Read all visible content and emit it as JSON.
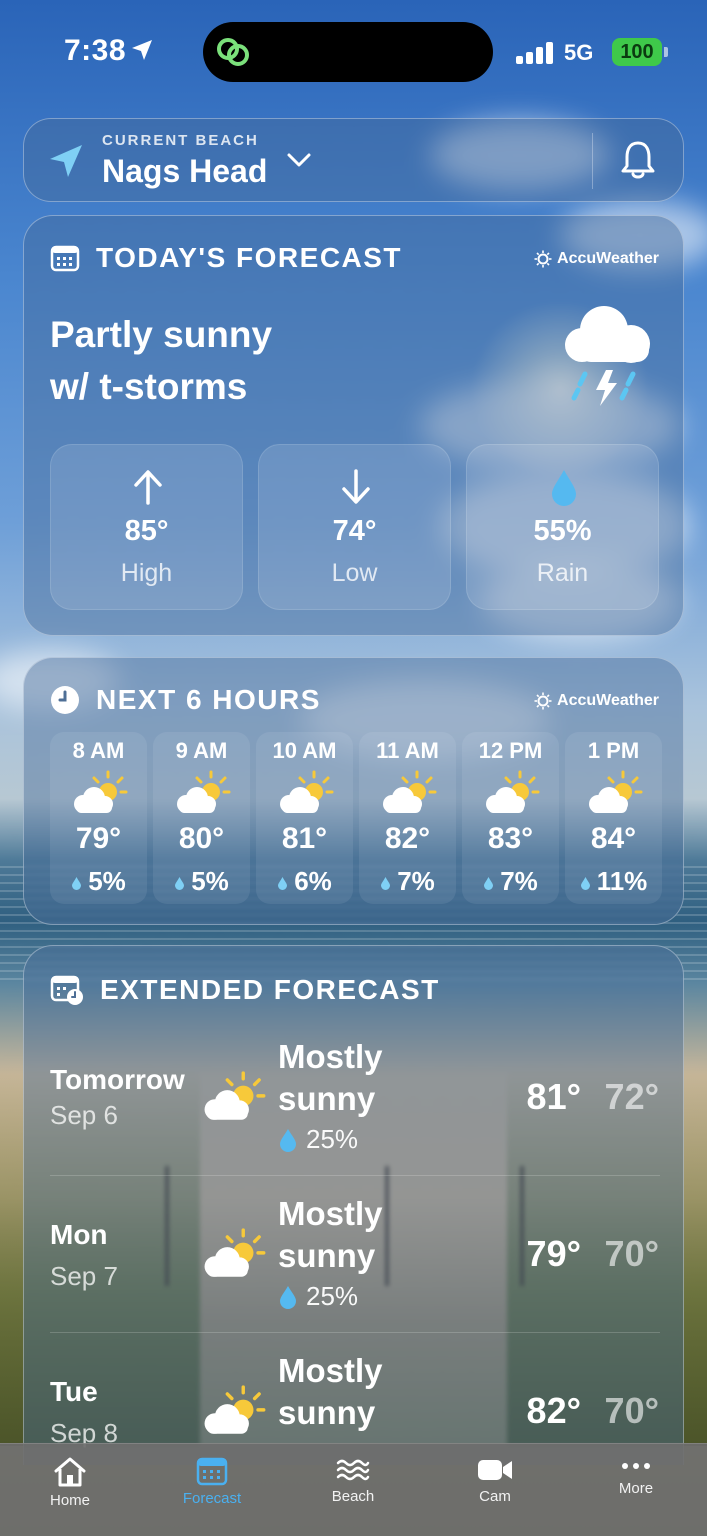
{
  "status_bar": {
    "time": "7:38",
    "network": "5G",
    "battery": "100"
  },
  "location": {
    "kicker": "CURRENT BEACH",
    "name": "Nags Head"
  },
  "today": {
    "title": "TODAY'S FORECAST",
    "provider": "AccuWeather",
    "condition_line1": "Partly sunny",
    "condition_line2": "w/ t-storms",
    "icon": "thunderstorm-icon",
    "stats": [
      {
        "value": "85°",
        "label": "High",
        "icon": "arrow-up-icon"
      },
      {
        "value": "74°",
        "label": "Low",
        "icon": "arrow-down-icon"
      },
      {
        "value": "55%",
        "label": "Rain",
        "icon": "raindrop-icon"
      }
    ]
  },
  "hourly": {
    "title": "NEXT 6 HOURS",
    "provider": "AccuWeather",
    "hours": [
      {
        "time": "8 AM",
        "temp": "79°",
        "precip": "5%"
      },
      {
        "time": "9 AM",
        "temp": "80°",
        "precip": "5%"
      },
      {
        "time": "10 AM",
        "temp": "81°",
        "precip": "6%"
      },
      {
        "time": "11 AM",
        "temp": "82°",
        "precip": "7%"
      },
      {
        "time": "12 PM",
        "temp": "83°",
        "precip": "7%"
      },
      {
        "time": "1 PM",
        "temp": "84°",
        "precip": "11%"
      }
    ]
  },
  "extended": {
    "title": "EXTENDED FORECAST",
    "days": [
      {
        "day": "Tomorrow",
        "date": "Sep 6",
        "cond1": "Mostly",
        "cond2": "sunny",
        "rain": "25%",
        "high": "81°",
        "low": "72°"
      },
      {
        "day": "Mon",
        "date": "Sep 7",
        "cond1": "Mostly",
        "cond2": "sunny",
        "rain": "25%",
        "high": "79°",
        "low": "70°"
      },
      {
        "day": "Tue",
        "date": "Sep 8",
        "cond1": "Mostly",
        "cond2": "sunny",
        "rain": "",
        "high": "82°",
        "low": "70°"
      }
    ]
  },
  "tabs": [
    {
      "label": "Home",
      "icon": "home-icon"
    },
    {
      "label": "Forecast",
      "icon": "calendar-icon",
      "active": true
    },
    {
      "label": "Beach",
      "icon": "waves-icon"
    },
    {
      "label": "Cam",
      "icon": "video-camera-icon"
    },
    {
      "label": "More",
      "icon": "more-dots-icon"
    }
  ],
  "colors": {
    "accent": "#4ab0f0",
    "battery": "#3fc94a",
    "card": "#4669968a"
  }
}
